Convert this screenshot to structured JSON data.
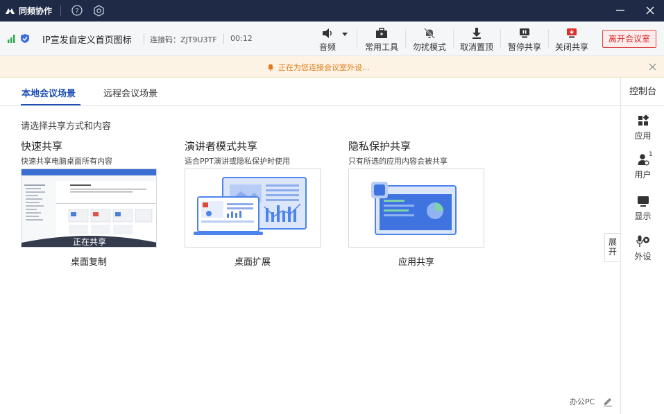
{
  "titlebar": {
    "app_name": "同频协作"
  },
  "toolbar": {
    "room_name": "IP宣发自定义首页图标",
    "connection_code": "连接码：ZJT9U3TF",
    "timer": "00:12",
    "tools": [
      {
        "label": "音频",
        "icon": "speaker-icon"
      },
      {
        "label": "常用工具",
        "icon": "toolbox-icon"
      },
      {
        "label": "勿扰模式",
        "icon": "bell-off-icon"
      },
      {
        "label": "取消置顶",
        "icon": "unpin-icon"
      },
      {
        "label": "暂停共享",
        "icon": "pause-share-icon"
      },
      {
        "label": "关闭共享",
        "icon": "stop-share-icon"
      }
    ],
    "leave_button": "离开会议室"
  },
  "notice": {
    "text": "正在为您连接会议室外设..."
  },
  "tabs": [
    {
      "label": "本地会议场景",
      "active": true
    },
    {
      "label": "远程会议场景",
      "active": false
    }
  ],
  "content": {
    "prompt": "请选择共享方式和内容",
    "options": [
      {
        "title": "快速共享",
        "desc": "快速共享电脑桌面所有内容",
        "label": "桌面复制",
        "status": "正在共享"
      },
      {
        "title": "演讲者模式共享",
        "desc": "适合PPT演讲或隐私保护时使用",
        "label": "桌面扩展"
      },
      {
        "title": "隐私保护共享",
        "desc": "只有所选的应用内容会被共享",
        "label": "应用共享"
      }
    ]
  },
  "sidepanel": {
    "title": "控制台",
    "items": [
      {
        "label": "应用",
        "icon": "apps-icon"
      },
      {
        "label": "用户",
        "icon": "user-icon",
        "badge": "1"
      },
      {
        "label": "显示",
        "icon": "display-icon"
      },
      {
        "label": "外设",
        "icon": "peripheral-icon"
      }
    ],
    "expand_label": "展开"
  },
  "footer": {
    "device_name": "办公PC"
  },
  "colors": {
    "titlebar_bg": "#1f2a47",
    "accent_blue": "#1d4fb3",
    "notice_text": "#e07b1a",
    "leave_red": "#d82c2c"
  }
}
